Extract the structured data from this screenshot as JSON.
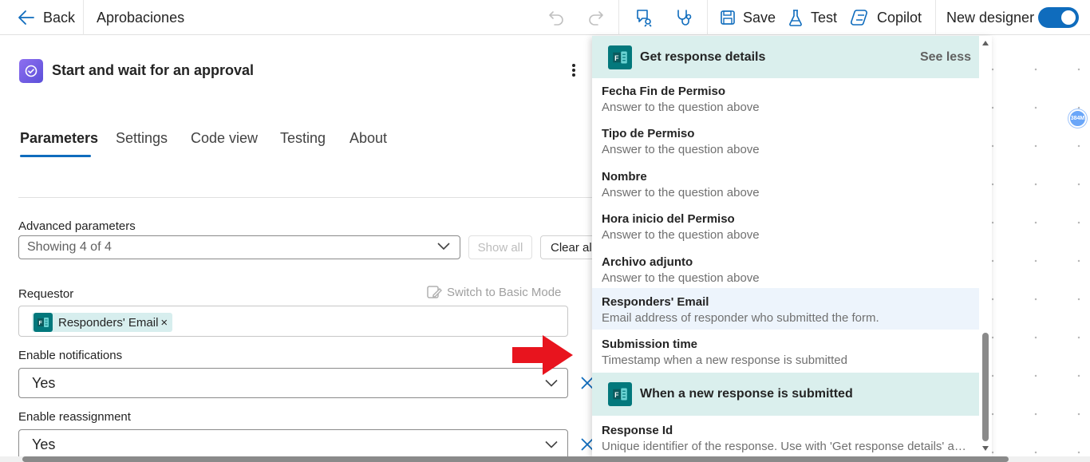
{
  "topbar": {
    "back_label": "Back",
    "flow_name": "Aprobaciones",
    "save_label": "Save",
    "test_label": "Test",
    "copilot_label": "Copilot",
    "new_designer_label": "New designer",
    "new_designer_on": true
  },
  "action": {
    "title": "Start and wait for an approval"
  },
  "tabs": [
    {
      "label": "Parameters",
      "active": true
    },
    {
      "label": "Settings"
    },
    {
      "label": "Code view"
    },
    {
      "label": "Testing"
    },
    {
      "label": "About"
    }
  ],
  "advanced": {
    "label": "Advanced parameters",
    "value": "Showing 4 of 4",
    "show_all": "Show all",
    "clear_all": "Clear all"
  },
  "requestor": {
    "label": "Requestor",
    "switch_mode": "Switch to Basic Mode",
    "token": "Responders' Email",
    "token_remove": "×"
  },
  "notifications": {
    "label": "Enable notifications",
    "value": "Yes"
  },
  "reassignment": {
    "label": "Enable reassignment",
    "value": "Yes"
  },
  "dropdown": {
    "section1_title": "Get response details",
    "section1_link": "See less",
    "items1": [
      {
        "title": "Fecha Fin de Permiso",
        "desc": "Answer to the question above"
      },
      {
        "title": "Tipo de Permiso",
        "desc": "Answer to the question above"
      },
      {
        "title": "Nombre",
        "desc": "Answer to the question above"
      },
      {
        "title": "Hora inicio del Permiso",
        "desc": "Answer to the question above"
      },
      {
        "title": "Archivo adjunto",
        "desc": "Answer to the question above"
      },
      {
        "title": "Responders' Email",
        "desc": "Email address of responder who submitted the form."
      },
      {
        "title": "Submission time",
        "desc": "Timestamp when a new response is submitted"
      }
    ],
    "section2_title": "When a new response is submitted",
    "items2": [
      {
        "title": "Response Id",
        "desc": "Unique identifier of the response. Use with 'Get response details' ac..."
      }
    ]
  },
  "canvas_node_label": "384M",
  "colors": {
    "accent": "#0f6cbd",
    "forms_green": "#03787c",
    "header_teal": "#daefed",
    "arrow_red": "#e8141e"
  }
}
